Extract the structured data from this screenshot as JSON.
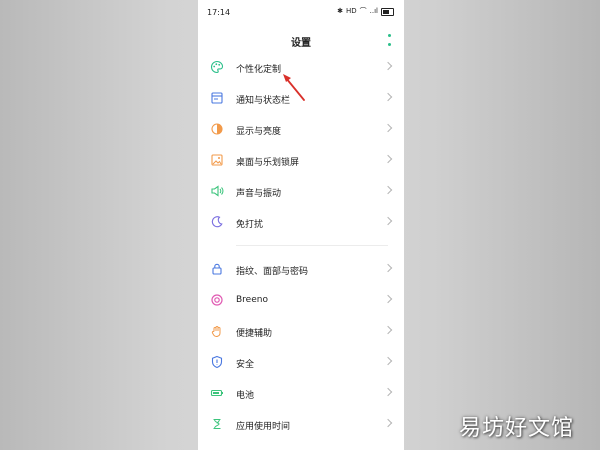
{
  "status_bar": {
    "time": "17:14",
    "icons": [
      "bluetooth-icon",
      "hd-icon",
      "wifi-icon",
      "signal-icon",
      "battery-icon"
    ],
    "labels": [
      "✱",
      "HD",
      "⌒",
      "..ıl",
      ""
    ]
  },
  "header": {
    "title": "设置"
  },
  "settings": {
    "items": [
      {
        "label": "个性化定制",
        "icon": "palette-icon"
      },
      {
        "label": "通知与状态栏",
        "icon": "notification-icon"
      },
      {
        "label": "显示与亮度",
        "icon": "brightness-icon"
      },
      {
        "label": "桌面与乐划锁屏",
        "icon": "wallpaper-icon"
      },
      {
        "label": "声音与振动",
        "icon": "speaker-icon"
      },
      {
        "label": "免打扰",
        "icon": "moon-icon"
      },
      {
        "label": "指纹、面部与密码",
        "icon": "lock-icon"
      },
      {
        "label": "Breeno",
        "icon": "breeno-icon"
      },
      {
        "label": "便捷辅助",
        "icon": "hand-icon"
      },
      {
        "label": "安全",
        "icon": "shield-icon"
      },
      {
        "label": "电池",
        "icon": "battery-icon"
      },
      {
        "label": "应用使用时间",
        "icon": "timer-icon"
      }
    ]
  },
  "colors": {
    "accent": "#2bbf8a",
    "annotation_arrow": "#d9302a",
    "orange": "#f29a4a",
    "green": "#3cc47c",
    "purple": "#7a6ee0",
    "pink": "#e05ab2",
    "blue": "#4a78e0"
  },
  "watermark": {
    "text": "易坊好文馆"
  }
}
